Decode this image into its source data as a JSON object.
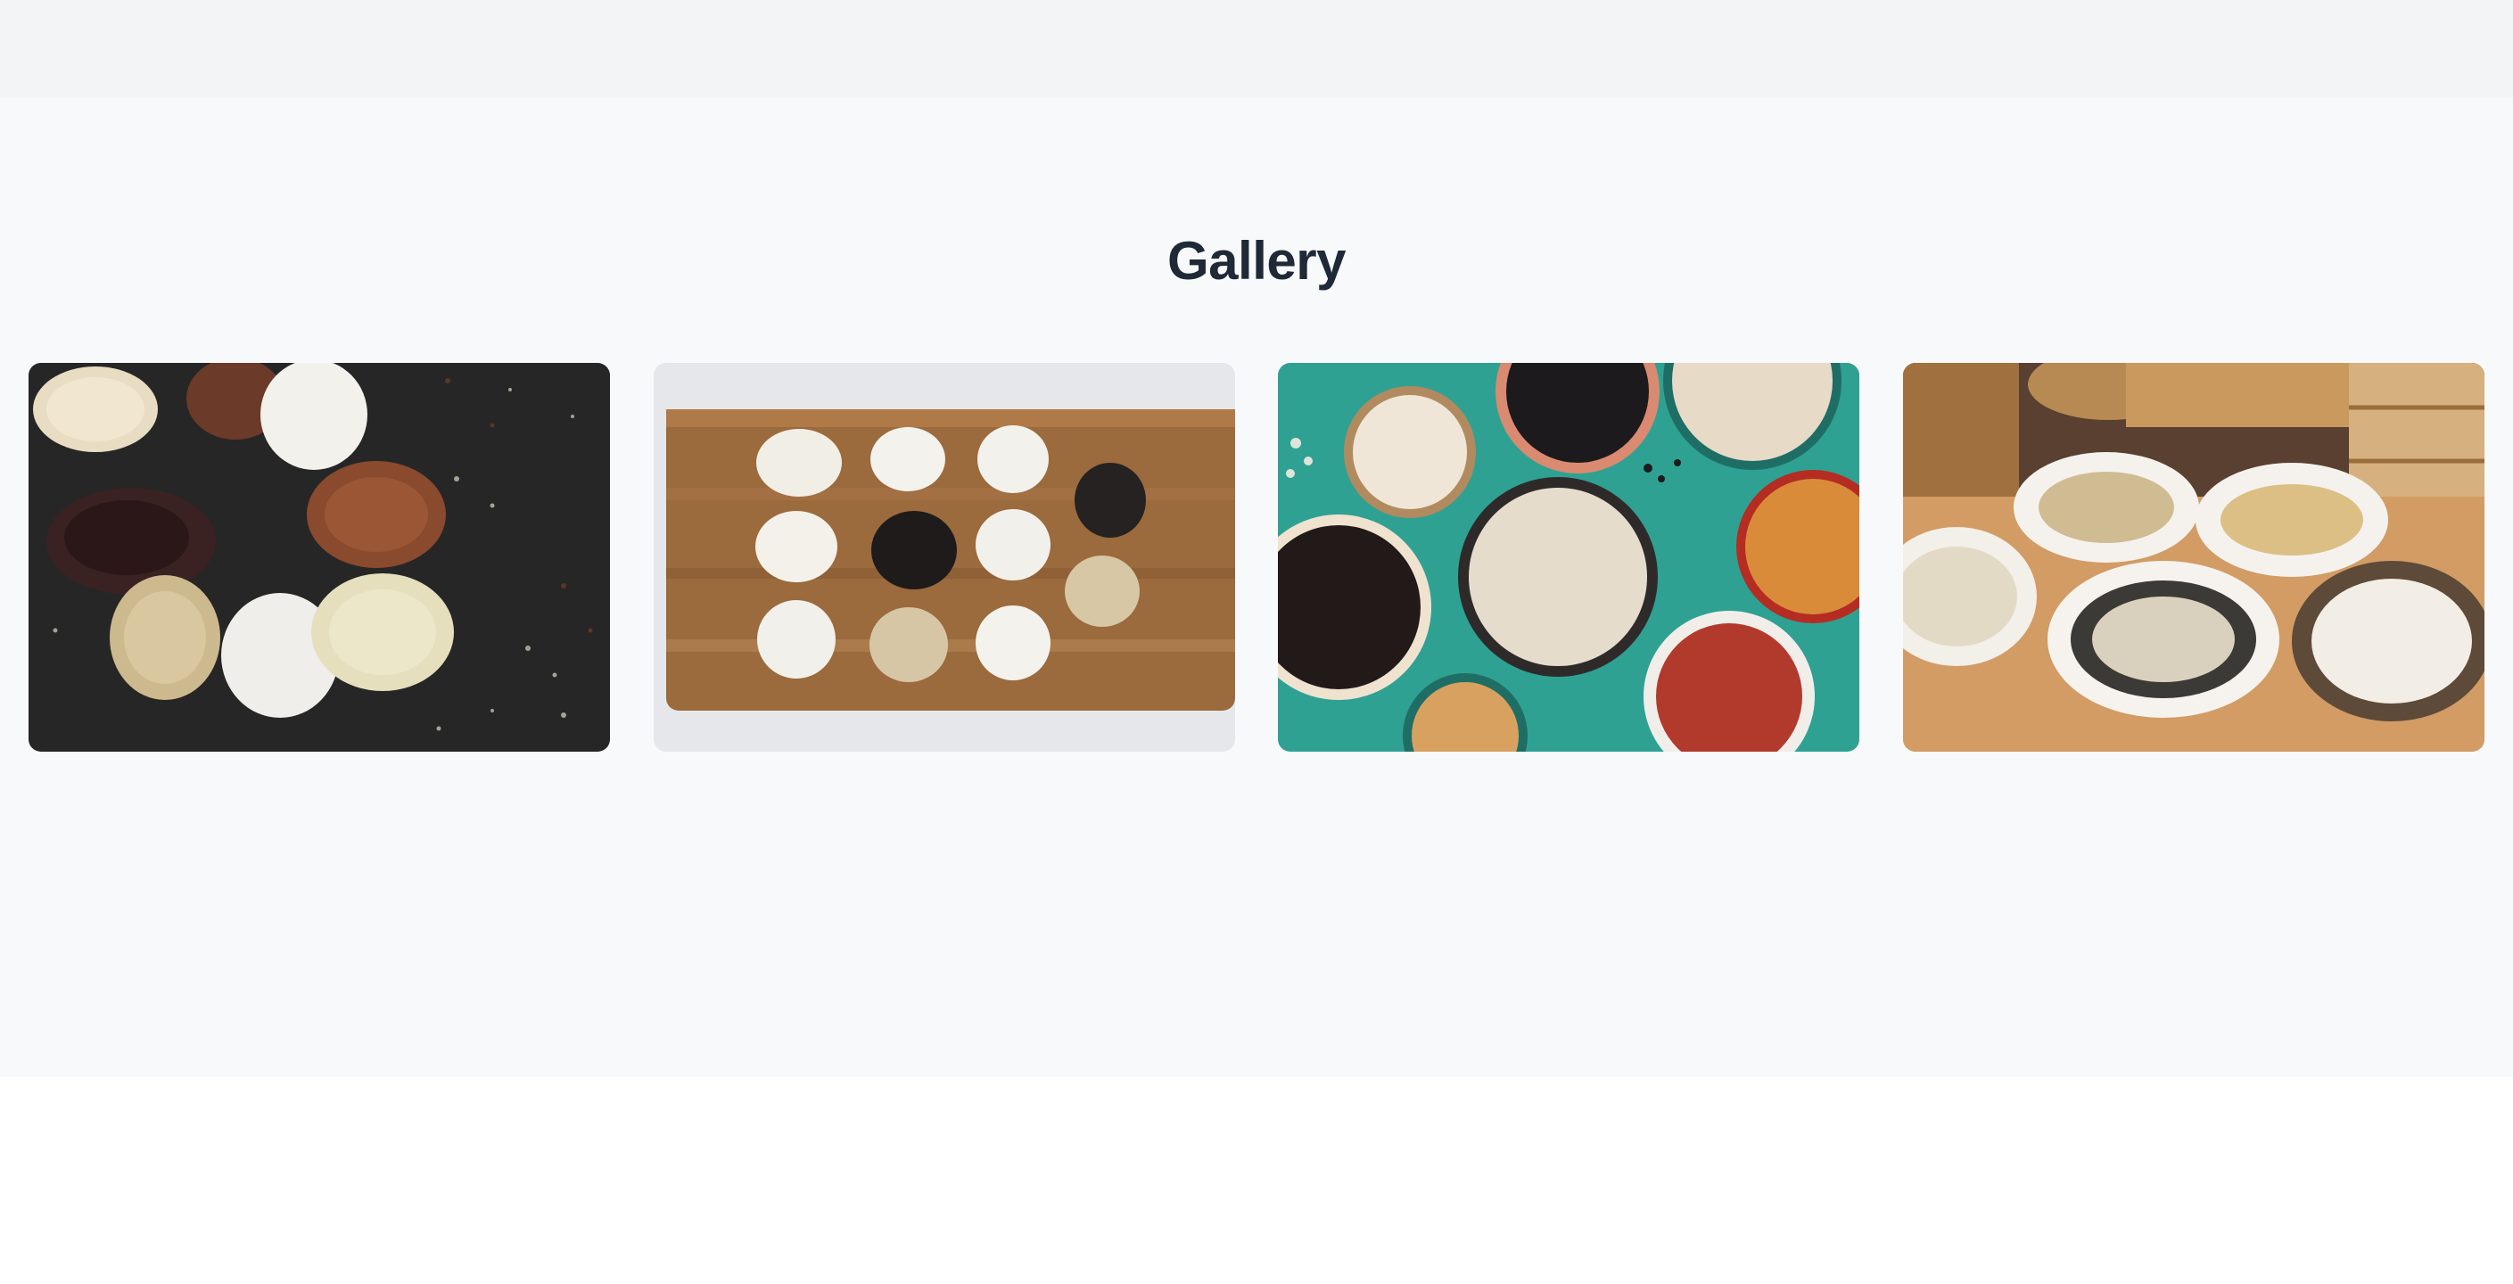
{
  "gallery": {
    "title": "Gallery",
    "images": [
      {
        "id": "rice-varieties-dark-board",
        "subject": "rice-varieties-on-dark-surface"
      },
      {
        "id": "rice-on-cutting-board",
        "subject": "rice-piles-on-wooden-board"
      },
      {
        "id": "grains-in-bowls-teal",
        "subject": "grain-bowls-on-teal-surface"
      },
      {
        "id": "grains-in-bowls-wood",
        "subject": "grain-bowls-on-wooden-table"
      }
    ]
  },
  "colors": {
    "topbar": "#f3f4f6",
    "section_bg": "#f8f9fb",
    "title": "#1f2937",
    "page_bg": "#ffffff"
  }
}
